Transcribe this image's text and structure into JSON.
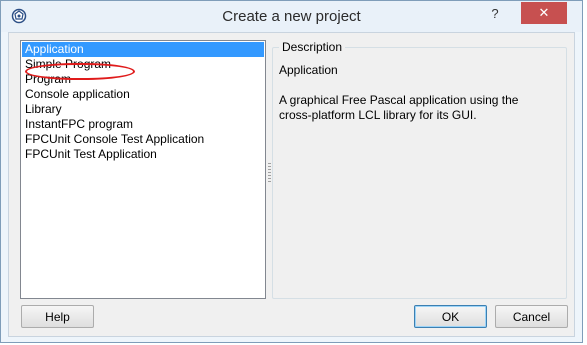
{
  "window": {
    "title": "Create a new project",
    "help_glyph": "?",
    "close_glyph": "✕"
  },
  "project_list": {
    "items": [
      "Application",
      "Simple Program",
      "Program",
      "Console application",
      "Library",
      "InstantFPC program",
      "FPCUnit Console Test Application",
      "FPCUnit Test Application"
    ],
    "selected": "Application",
    "circled": "Simple Program"
  },
  "description": {
    "group_label": "Description",
    "title": "Application",
    "text": "A graphical Free Pascal application using the cross-platform LCL library for its GUI."
  },
  "buttons": {
    "help": "Help",
    "ok": "OK",
    "cancel": "Cancel"
  },
  "colors": {
    "selection": "#3399ff",
    "close_button": "#c75050",
    "annotation": "#e01b1b"
  },
  "icons": {
    "app": "lazarus-icon"
  }
}
